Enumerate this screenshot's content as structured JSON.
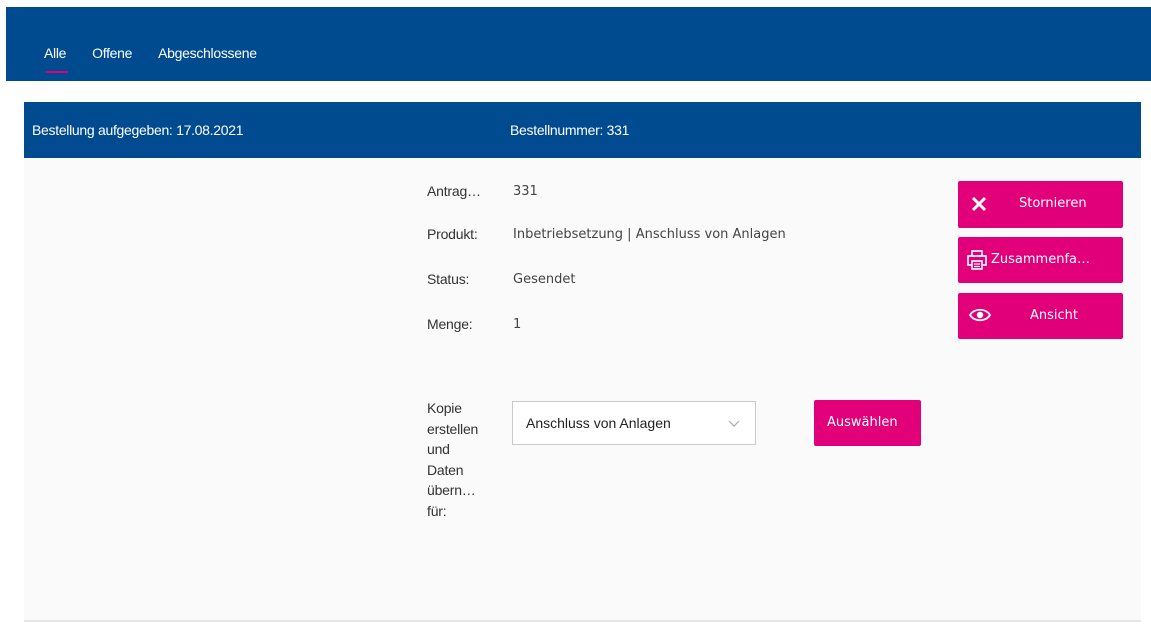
{
  "tabs": {
    "all": "Alle",
    "open": "Offene",
    "closed": "Abgeschlossene"
  },
  "order": {
    "placed_label": "Bestellung aufgegeben:",
    "placed_date": "17.08.2021",
    "number_label": "Bestellnummer:",
    "number_value": "331"
  },
  "details": {
    "request_label": "Antrag…",
    "request_value": "331",
    "product_label": "Produkt:",
    "product_value": "Inbetriebsetzung | Anschluss von Anlagen",
    "status_label": "Status:",
    "status_value": "Gesendet",
    "quantity_label": "Menge:",
    "quantity_value": "1"
  },
  "copy": {
    "label_line1": "Kopie",
    "label_line2": "erstellen",
    "label_line3": "und",
    "label_line4": "Daten",
    "label_line5": "übern…",
    "label_line6": "für:",
    "selected_option": "Anschluss von Anlagen",
    "select_button": "Auswählen"
  },
  "actions": {
    "cancel": "Stornieren",
    "summary": "Zusammenfa…",
    "view": "Ansicht"
  },
  "icons": {
    "cancel": "close-icon",
    "summary": "printer-icon",
    "view": "eye-icon",
    "dropdown": "chevron-down-icon"
  },
  "colors": {
    "primary": "#004a8f",
    "accent": "#e2007a"
  }
}
